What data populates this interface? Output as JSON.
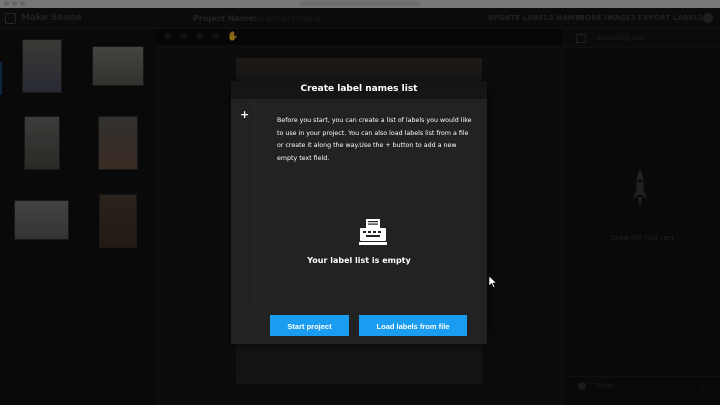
{
  "topbar": {
    "app_title": "Make Sense",
    "project_label": "Project Name:",
    "project_name": "my-project-name",
    "nav": [
      "UPDATE LABELS NAMES",
      "MORE IMAGES",
      "EXPORT LABELS"
    ]
  },
  "right_panel": {
    "title": "Bounding box",
    "empty_message": "Draw the first rect",
    "bottom_label": "Point"
  },
  "modal": {
    "title": "Create label names list",
    "add_symbol": "+",
    "description": "Before you start, you can create a list of labels you would like to use in your project. You can also load labels list from a file or create it along the way.Use the + button to add a new empty text field.",
    "empty_text": "Your label list is empty",
    "start_button": "Start project",
    "load_button": "Load labels from file"
  },
  "colors": {
    "accent": "#1a9cf0",
    "modal_bg": "#222222",
    "header_bg": "#151515"
  },
  "icons": [
    "zoom-in-icon",
    "zoom-out-icon",
    "zoom-fit-icon",
    "zoom-reset-icon",
    "hand-icon",
    "rocket-icon",
    "typewriter-icon",
    "github-icon"
  ]
}
